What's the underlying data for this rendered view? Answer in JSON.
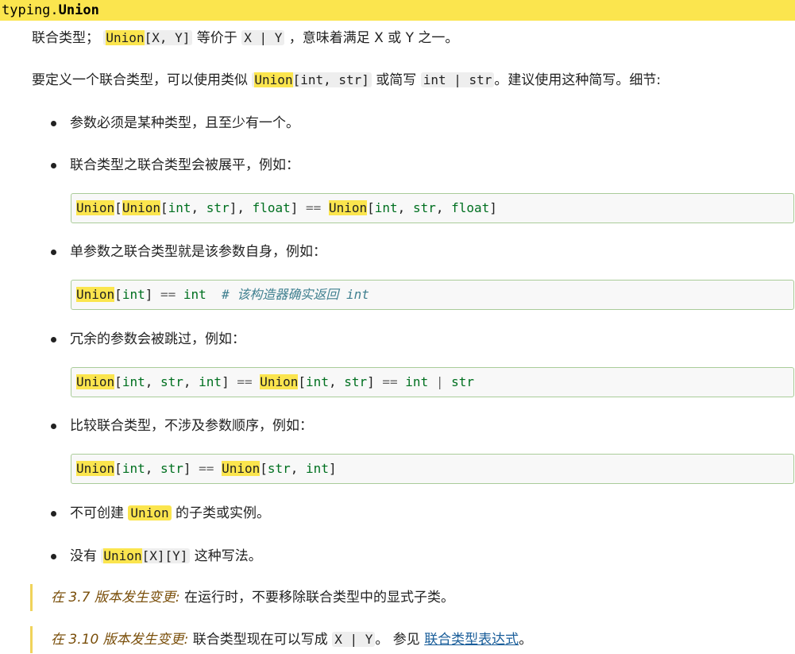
{
  "signature": {
    "module": "typing.",
    "name": "Union"
  },
  "intro": {
    "prefix": "联合类型；",
    "union_xy_kw": "Union",
    "union_xy_rest": "[X, Y]",
    "mid": "等价于",
    "x_or_y": "X | Y",
    "suffix": "，意味着满足 X 或 Y 之一。"
  },
  "define": {
    "prefix": "要定义一个联合类型，可以使用类似",
    "union_kw": "Union",
    "union_rest": "[int, str]",
    "mid": "或简写",
    "short": "int | str",
    "suffix": "。建议使用这种简写。细节:"
  },
  "bullets": {
    "b1": "参数必须是某种类型，且至少有一个。",
    "b2": "联合类型之联合类型会被展平，例如：",
    "b3": "单参数之联合类型就是该参数自身，例如：",
    "b4": "冗余的参数会被跳过，例如：",
    "b5": "比较联合类型，不涉及参数顺序，例如：",
    "b6_prefix": "不可创建",
    "b6_code": "Union",
    "b6_suffix": "的子类或实例。",
    "b7_prefix": "没有",
    "b7_code_kw": "Union",
    "b7_code_rest": "[X][Y]",
    "b7_suffix": "这种写法。"
  },
  "code": {
    "union": "Union",
    "int": "int",
    "str": "str",
    "float": "float",
    "eq": "==",
    "pipe": "|",
    "comment": "# 该构造器确实返回 int"
  },
  "version_changes": {
    "v37_label": "在 3.7 版本发生变更:",
    "v37_text": "在运行时，不要移除联合类型中的显式子类。",
    "v310_label": "在 3.10 版本发生变更:",
    "v310_text": "联合类型现在可以写成",
    "v310_code": "X | Y",
    "v310_mid": "。 参见",
    "v310_link": "联合类型表达式",
    "v310_end": "。"
  }
}
